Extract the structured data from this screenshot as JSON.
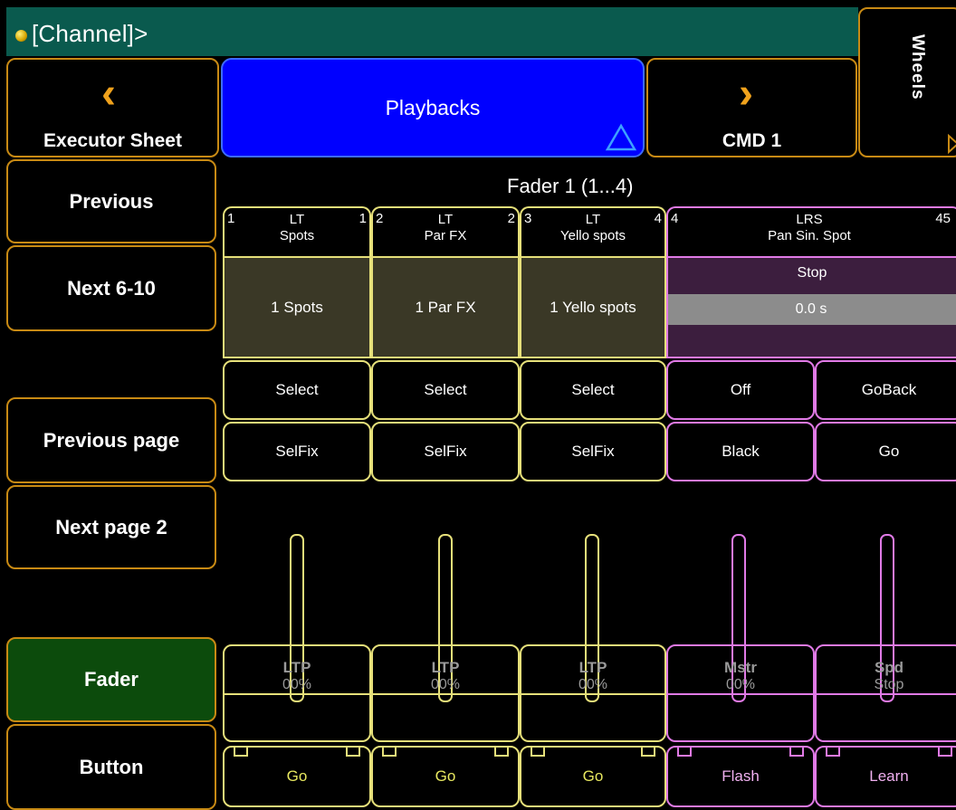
{
  "command_line": {
    "text": "[Channel]>"
  },
  "nav": {
    "left": {
      "label": "Executor Sheet"
    },
    "center": {
      "label": "Playbacks"
    },
    "right": {
      "label": "CMD 1"
    },
    "wheels": {
      "label": "Wheels"
    }
  },
  "sidebar": {
    "items": [
      {
        "label": "Previous"
      },
      {
        "label": "Next 6-10"
      },
      {
        "label": "Previous page"
      },
      {
        "label": "Next page 2"
      },
      {
        "label": "Fader"
      },
      {
        "label": "Button"
      }
    ]
  },
  "fader_title": "Fader 1 (1...4)",
  "executors": [
    {
      "num_left": "1",
      "num_right": "1",
      "type": "LT",
      "name": "Spots",
      "cue": "1 Spots",
      "btn1": "Select",
      "btn2": "SelFix",
      "fader_label": "LTP",
      "fader_value": "00%",
      "go": "Go",
      "color": "#e6e07a"
    },
    {
      "num_left": "2",
      "num_right": "2",
      "type": "LT",
      "name": "Par FX",
      "cue": "1 Par FX",
      "btn1": "Select",
      "btn2": "SelFix",
      "fader_label": "LTP",
      "fader_value": "00%",
      "go": "Go",
      "color": "#e6e07a"
    },
    {
      "num_left": "3",
      "num_right": "4",
      "type": "LT",
      "name": "Yello spots",
      "cue": "1 Yello spots",
      "btn1": "Select",
      "btn2": "SelFix",
      "fader_label": "LTP",
      "fader_value": "00%",
      "go": "Go",
      "color": "#e6e07a"
    }
  ],
  "executor4": {
    "num_left": "4",
    "num_right": "45",
    "type": "LRS",
    "name": "Pan Sin. Spot",
    "status": "Stop",
    "time": "0.0 s",
    "btn_off": "Off",
    "btn_goback": "GoBack",
    "btn_black": "Black",
    "btn_go": "Go",
    "fader1_label": "Mstr",
    "fader1_value": "00%",
    "fader2_label": "Spd",
    "fader2_value": "Stop",
    "flash": "Flash",
    "learn": "Learn",
    "color": "#e07ae6"
  },
  "colors": {
    "accent_orange": "#c88a14",
    "playbacks_blue": "#0000ff",
    "cmdline_teal": "#0a5a4e",
    "fader_green": "#0c4b0c"
  },
  "icons": [
    "status-dot-icon",
    "chevron-left-icon",
    "chevron-right-icon",
    "triangle-icon"
  ]
}
